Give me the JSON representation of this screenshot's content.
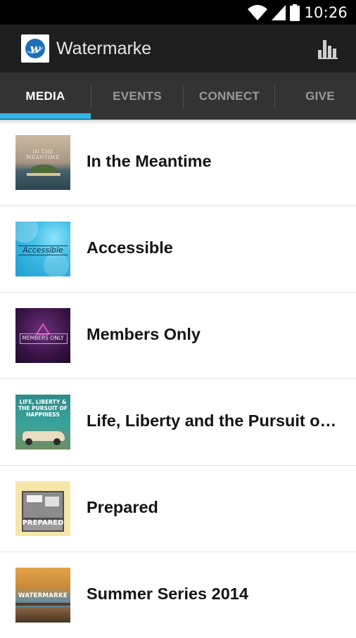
{
  "status_bar": {
    "time": "10:26"
  },
  "action_bar": {
    "title": "Watermarke",
    "logo_letter": "w"
  },
  "tabs": [
    {
      "label": "MEDIA",
      "active": true
    },
    {
      "label": "EVENTS",
      "active": false
    },
    {
      "label": "CONNECT",
      "active": false
    },
    {
      "label": "GIVE",
      "active": false
    }
  ],
  "colors": {
    "accent": "#33b5e5",
    "action_bar": "#1e1e1e",
    "tab_bar": "#333333"
  },
  "series": [
    {
      "title": "In the Meantime",
      "thumb_text": "IN THE MEANTIME"
    },
    {
      "title": "Accessible",
      "thumb_text": "Accessible"
    },
    {
      "title": "Members Only",
      "thumb_text": "MEMBERS ONLY"
    },
    {
      "title": "Life, Liberty and the Pursuit of Happiness",
      "thumb_text": "LIFE, LIBERTY & THE PURSUIT OF HAPPINESS"
    },
    {
      "title": "Prepared",
      "thumb_text": "PREPARED"
    },
    {
      "title": "Summer Series 2014",
      "thumb_text": "WATERMARKE"
    }
  ]
}
